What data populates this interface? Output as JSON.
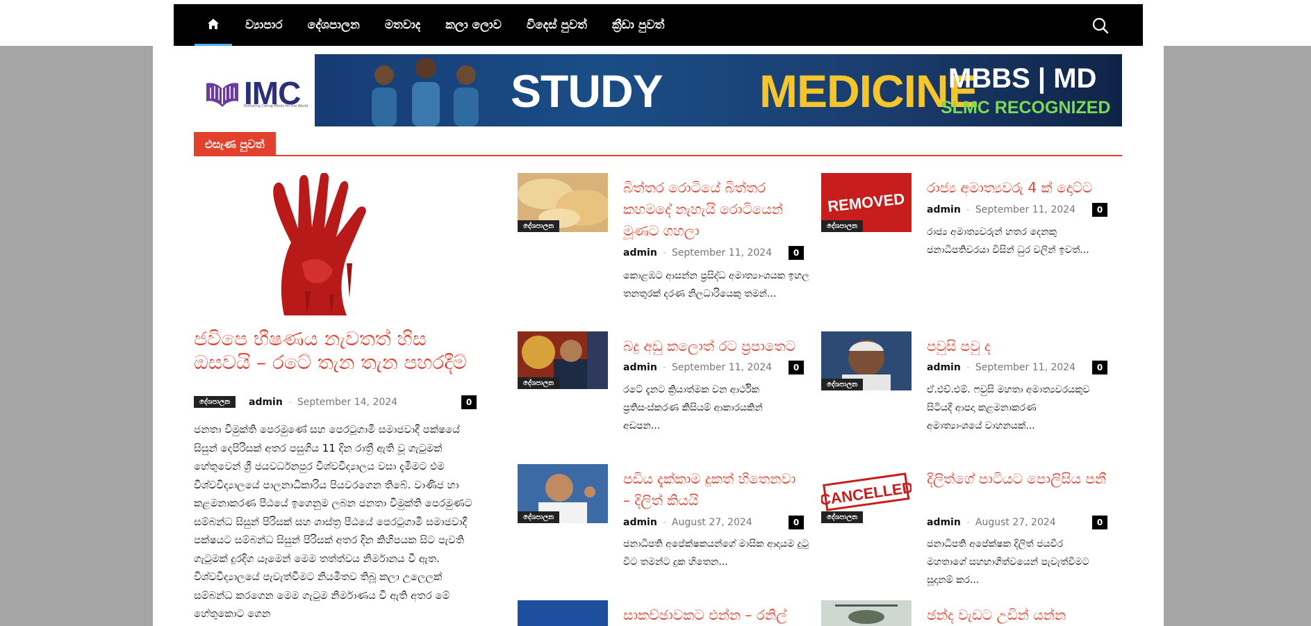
{
  "nav": {
    "items": [
      "ව්‍යාපාර",
      "දේශපාලන",
      "මතවාද",
      "කලා ලොව",
      "විදෙස් පුවත්",
      "ක්‍රීඩා පුවත්"
    ]
  },
  "logo": {
    "text": "IMC",
    "tagline": "Nurturing Caring Minds for the World"
  },
  "banner": {
    "line1": "STUDY",
    "line2": "MEDICINE",
    "line3": "MBBS | MD",
    "line4": "SLMC RECOGNIZED"
  },
  "section": {
    "label": "එසැණ පුවත්"
  },
  "featured": {
    "title": "ජවිපෙ භීෂණය නැවතත් හිස ඔසවයි – රටේ තැන තැන පහරදීම්",
    "category": "දේශපාලන",
    "author": "admin",
    "date": "September 14, 2024",
    "comments": "0",
    "excerpt": "ජනතා විමුක්ති පෙරමුණේ සහ පෙරටුගාමී සමාජවාදී පක්ෂයේ සිසුන් දෙපිරිසක් අතර පසුගිය 11 දින රාත්‍රී ඇති වූ ගැටුමක් හේතුවෙන් ශ්‍රී ජයවර්ධනපුර විශ්වවිද්‍යාලය වසා දැමීමට එම විශ්වවිද්‍යාලයේ පාලනාධිකාරිය පියවරගෙන තිබේ. වාණිජ හා කළමනාකරණ පීඨයේ ඉගෙනුම ලබන ජනතා විමුක්ති පෙරමුණට සම්බන්ධ සිසුන් පිරිසක් සහ ශාස්ත්‍ර පීඨයේ පෙරටුගාමී සමාජවාදී පක්ෂයට සම්බන්ධ සිසුන් පිරිසක් අතර දින කිහිපයක සිට පැවති ගැටුමක් දුරදිග යෑමෙන් මෙම තත්ත්වය නිර්මානය වී ඇත. විශ්වවිද්‍යාලයේ පැවැත්වීමට නියමිතව තිබූ කලා උලෙලක් සම්බන්ධ කරගෙන මෙම ගැටුම නිර්මාණය වී ඇති අතර මේ හේතුකොට ගෙන"
  },
  "posts": [
    {
      "title": "බිත්තර රොටියේ බිත්තර කහමදේ නැහැයි රොටියෙන් මූණට ගහලා",
      "category": "දේශපාලන",
      "author": "admin",
      "date": "September 11, 2024",
      "comments": "0",
      "excerpt": "කොළඹට ආසන්න ප්‍රසිද්ධ අමාත්‍යාංශයක ඉහල තනතුරක් දරණ නිලධාරියෙකු තමන්..."
    },
    {
      "title": "රාජ්‍ය අමාත්‍යවරු 4 ක් දොට්ට",
      "category": "දේශපාලන",
      "author": "admin",
      "date": "September 11, 2024",
      "comments": "0",
      "excerpt": "රාජ්‍ය අමාත්‍යවරුන් හතර දෙනකු ජනාධිපතිවරයා විසින් ධුර වලින් ඉවත්...",
      "image_text": "REMOVED"
    },
    {
      "title": "බදු අඩු කලොත් රට ප්‍රපාතෙට",
      "category": "දේශපාලන",
      "author": "admin",
      "date": "September 11, 2024",
      "comments": "0",
      "excerpt": "රටේ දැනට ක්‍රියාත්මක වන ආර්ථික ප්‍රතිසංස්කරණ කිසියම් ආකාරයකින් අඩපන..."
    },
    {
      "title": "පවුසි පවු ද",
      "category": "දේශපාලන",
      "author": "admin",
      "date": "September 11, 2024",
      "comments": "0",
      "excerpt": "ඒ.එච්.එම්. ෆවුසි මහතා අමාත්‍යවරයකුව සිටියදී ආපදා කළමනාකරණ අමාත්‍යාංශයේ වාහනයක්..."
    },
    {
      "title": "පඩිය දැක්කාම දුකත් හිතෙනවා – දිලිත් කියයි",
      "category": "දේශපාලන",
      "author": "admin",
      "date": "August 27, 2024",
      "comments": "0",
      "excerpt": "ජනාධිපති අපේක්ෂකයන්ගේ මාසික ආදායම දුටු විට තමන්ට දුක හිතෙන..."
    },
    {
      "title": "දිලිත්ගේ පාටියට පොලිසිය පනී",
      "category": "දේශපාලන",
      "author": "admin",
      "date": "August 27, 2024",
      "comments": "0",
      "excerpt": "ජනාධිපති අපේක්ෂක දිලිත් ජයවීර මහතාගේ සහභාගීත්වයෙන් පැවැත්වීමට සූදානම් කර...",
      "image_text": "CANCELLED"
    },
    {
      "title": "සාකච්ඡාවකට එන්න – රනිල්"
    },
    {
      "title": "ඡන්ද වැඩට උඩින් යන්න"
    }
  ]
}
